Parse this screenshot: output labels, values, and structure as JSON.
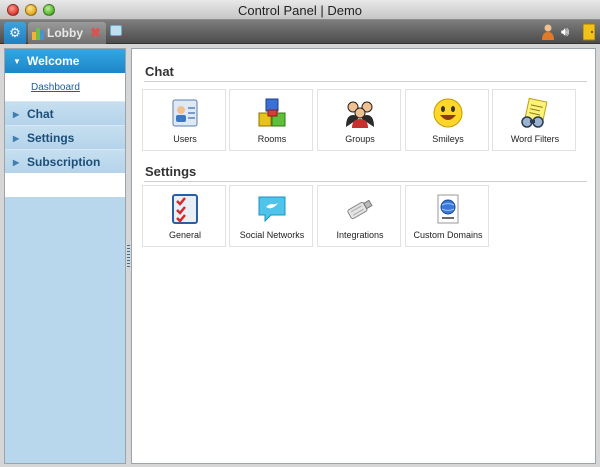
{
  "window": {
    "title": "Control Panel | Demo"
  },
  "toolbar": {
    "tabs": [
      {
        "label": "Lobby"
      }
    ]
  },
  "sidebar": {
    "items": [
      {
        "label": "Welcome",
        "expanded": true,
        "children": [
          {
            "label": "Dashboard"
          }
        ]
      },
      {
        "label": "Chat"
      },
      {
        "label": "Settings"
      },
      {
        "label": "Subscription"
      }
    ]
  },
  "main": {
    "sections": [
      {
        "title": "Chat",
        "tiles": [
          {
            "label": "Users",
            "icon": "users-icon"
          },
          {
            "label": "Rooms",
            "icon": "rooms-icon"
          },
          {
            "label": "Groups",
            "icon": "groups-icon"
          },
          {
            "label": "Smileys",
            "icon": "smileys-icon"
          },
          {
            "label": "Word Filters",
            "icon": "word-filters-icon"
          }
        ]
      },
      {
        "title": "Settings",
        "tiles": [
          {
            "label": "General",
            "icon": "general-icon"
          },
          {
            "label": "Social Networks",
            "icon": "social-networks-icon"
          },
          {
            "label": "Integrations",
            "icon": "integrations-icon"
          },
          {
            "label": "Custom Domains",
            "icon": "custom-domains-icon"
          }
        ]
      }
    ]
  },
  "colors": {
    "accent": "#1c86c8",
    "sidebar_bg": "#b8d6ec",
    "toolbar": "#5a5a5a"
  }
}
